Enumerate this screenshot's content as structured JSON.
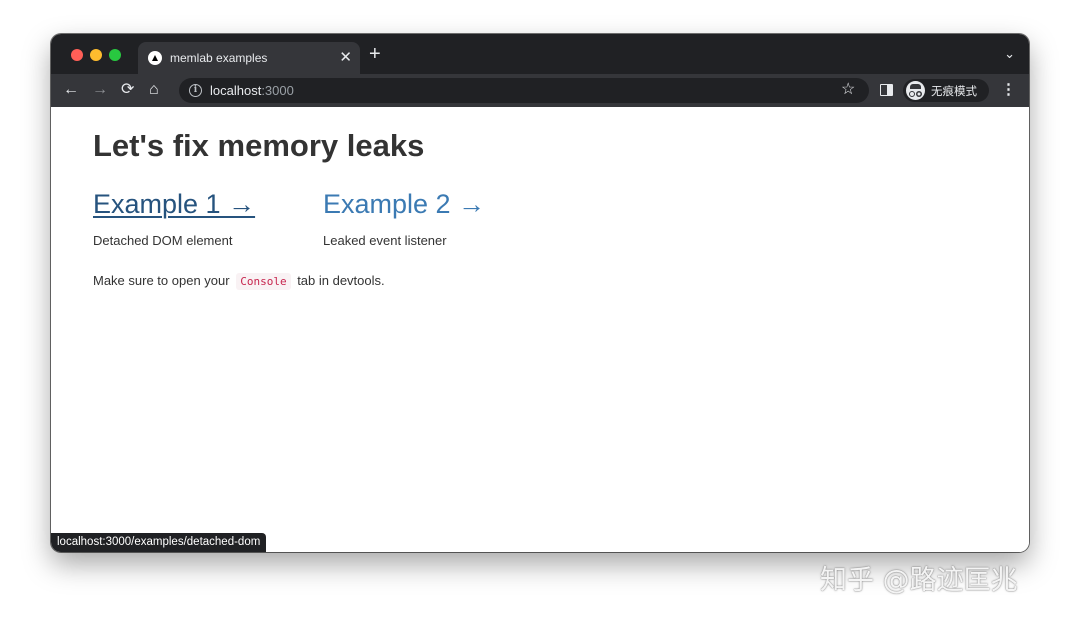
{
  "browser": {
    "tab": {
      "title": "memlab examples",
      "close": "✕"
    },
    "new_tab": "+",
    "tab_menu": "⌄",
    "nav": {
      "back": "←",
      "forward": "→",
      "reload": "⟳",
      "home": "⌂"
    },
    "address": {
      "host": "localhost",
      "port": ":3000"
    },
    "bookmark": "☆",
    "profile_label": "无痕模式",
    "menu": "⋮",
    "status_url": "localhost:3000/examples/detached-dom"
  },
  "page": {
    "title": "Let's fix memory leaks",
    "examples": [
      {
        "link": "Example 1 →",
        "description": "Detached DOM element"
      },
      {
        "link": "Example 2 →",
        "description": "Leaked event listener"
      }
    ],
    "note": {
      "before": "Make sure to open your",
      "code": "Console",
      "after": "tab in devtools."
    }
  },
  "watermark": "知乎 @路迹匡兆",
  "colors": {
    "link": "#3b7ab3",
    "link_hover": "#26537e",
    "code": "#c7254e",
    "titlebar": "#202124",
    "toolbar": "#35363a"
  }
}
